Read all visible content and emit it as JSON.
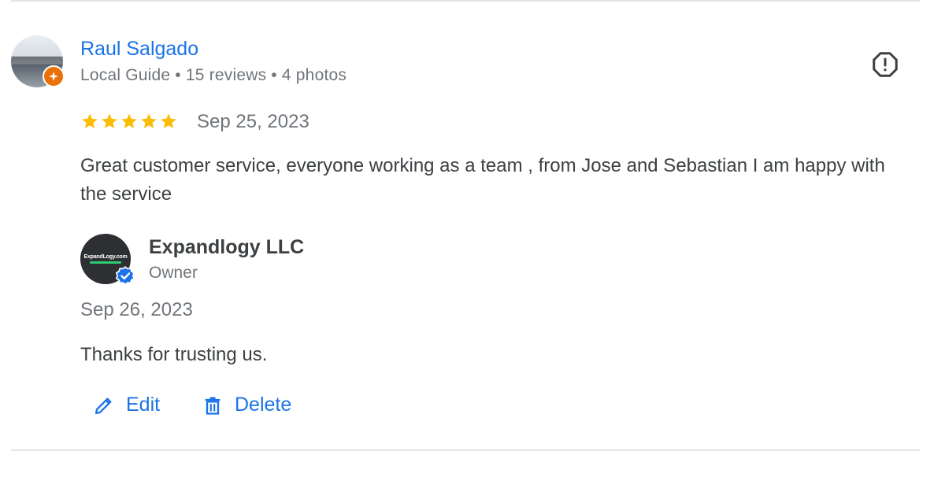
{
  "reviewer": {
    "name": "Raul Salgado",
    "meta": "Local Guide • 15 reviews • 4 photos",
    "badge_icon": "local-guide-badge-icon",
    "badge_color": "#e8710a"
  },
  "review": {
    "rating": 5,
    "date": "Sep 25, 2023",
    "text": "Great customer service, everyone working as a team , from Jose and Sebastian I am happy with the service"
  },
  "owner_reply": {
    "owner_name": "Expandlogy LLC",
    "owner_role": "Owner",
    "logo_text": "ExpandLogy.com",
    "date": "Sep 26, 2023",
    "text": "Thanks for trusting us."
  },
  "actions": {
    "edit_label": "Edit",
    "delete_label": "Delete"
  },
  "colors": {
    "link_blue": "#1a73e8",
    "star_yellow": "#fbbc04",
    "secondary_text": "#70757a"
  }
}
